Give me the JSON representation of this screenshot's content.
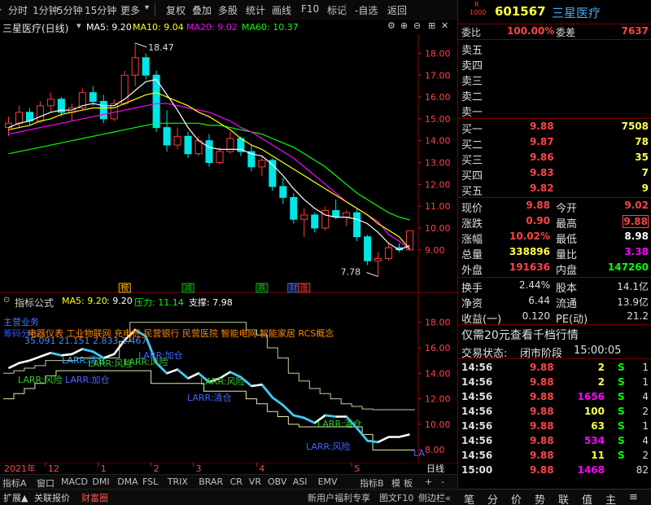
{
  "toolbar": {
    "buttons": [
      "分时",
      "1分钟",
      "5分钟",
      "15分钟",
      "更多",
      "复权",
      "叠加",
      "多股",
      "统计",
      "画线",
      "F10",
      "标记",
      "-自选",
      "返回"
    ],
    "more_arrow": "▾"
  },
  "header": {
    "stock_name": "三星医疗(日线)",
    "ma5": "MA5: 9.20",
    "ma10": "MA10: 9.04",
    "ma20": "MA20: 9.02",
    "ma60": "MA60: 10.37",
    "high_mark": "18.47",
    "low_mark": "7.78",
    "events": [
      "榜",
      "减",
      "跌",
      "财",
      "涨"
    ]
  },
  "indicator": {
    "title": "指标公式",
    "ma5": "MA5: 9.20",
    "val": ": 9.20",
    "pressure": "压力: 11.14",
    "support": "支撑: 7.98",
    "label_sector": "主营业务",
    "concepts": "电器仪表 工业物联网 充电桩 民营银行 民营医院 智能电网 智能家居 RCS概念",
    "label_cost": "筹码分布",
    "nums": "35.091 21.151 2.833 1.467",
    "larr_labels": [
      "LARR:风险",
      "LARR:清仓",
      "LARR:风险",
      "LARR:风险",
      "LARR:加仓",
      "LARR:清仓",
      "LARR:风险",
      "LARR:加仓",
      "LARR:清仓",
      "LARR:风险",
      "LA"
    ]
  },
  "axis": {
    "price_ticks": [
      "18.00",
      "17.00",
      "16.00",
      "15.00",
      "14.00",
      "13.00",
      "12.00",
      "11.00",
      "10.00",
      "9.00"
    ],
    "ind_ticks": [
      "18.00",
      "16.00",
      "14.00",
      "12.00",
      "10.00",
      "8.00"
    ],
    "time_labels": [
      "2021年",
      "12",
      "1",
      "2",
      "3",
      "4",
      "5"
    ],
    "period": "日线"
  },
  "tabs": [
    "指标A",
    "窗口",
    "MACD",
    "DMI",
    "DMA",
    "FSL",
    "TRIX",
    "BRAR",
    "CR",
    "VR",
    "OBV",
    "ASI",
    "EMV"
  ],
  "tabs_right": [
    "指标B",
    "模",
    "板",
    "+",
    "-"
  ],
  "bottom": [
    "扩展▲",
    "关联报价",
    "财富圈"
  ],
  "bottom_right": [
    "新用户福利专享",
    "图文F10",
    "侧边栏«"
  ],
  "quote": {
    "code": "601567",
    "name": "三星医疗",
    "badge_top": "R",
    "badge_bottom": "1000",
    "weibi_label": "委比",
    "weibi": "100.00%",
    "weicha_label": "委差",
    "weicha": "7637",
    "sell": [
      "卖五",
      "卖四",
      "卖三",
      "卖二",
      "卖一"
    ],
    "buy": [
      {
        "label": "买一",
        "price": "9.88",
        "vol": "7508"
      },
      {
        "label": "买二",
        "price": "9.87",
        "vol": "78"
      },
      {
        "label": "买三",
        "price": "9.86",
        "vol": "35"
      },
      {
        "label": "买四",
        "price": "9.83",
        "vol": "7"
      },
      {
        "label": "买五",
        "price": "9.82",
        "vol": "9"
      }
    ],
    "stats": [
      {
        "l1": "现价",
        "v1": "9.88",
        "l2": "今开",
        "v2": "9.02"
      },
      {
        "l1": "涨跌",
        "v1": "0.90",
        "l2": "最高",
        "v2": "9.88"
      },
      {
        "l1": "涨幅",
        "v1": "10.02%",
        "l2": "最低",
        "v2": "8.98"
      },
      {
        "l1": "总量",
        "v1": "338896",
        "l2": "量比",
        "v2": "3.38"
      },
      {
        "l1": "外盘",
        "v1": "191636",
        "l2": "内盘",
        "v2": "147260"
      }
    ],
    "stats2": [
      {
        "l1": "换手",
        "v1": "2.44%",
        "l2": "股本",
        "v2": "14.1亿"
      },
      {
        "l1": "净资",
        "v1": "6.44",
        "l2": "流通",
        "v2": "13.9亿"
      },
      {
        "l1": "收益(一)",
        "v1": "0.120",
        "l2": "PE(动)",
        "v2": "21.2"
      }
    ],
    "promo": "仅需20元查看千档行情",
    "status_label": "交易状态:",
    "status": "闭市阶段",
    "status_time": "15:00:05",
    "ticks": [
      {
        "t": "14:56",
        "p": "9.88",
        "v": "2",
        "s": "S",
        "n": "1"
      },
      {
        "t": "14:56",
        "p": "9.88",
        "v": "2",
        "s": "S",
        "n": "1"
      },
      {
        "t": "14:56",
        "p": "9.88",
        "v": "1656",
        "s": "S",
        "n": "4"
      },
      {
        "t": "14:56",
        "p": "9.88",
        "v": "100",
        "s": "S",
        "n": "2"
      },
      {
        "t": "14:56",
        "p": "9.88",
        "v": "63",
        "s": "S",
        "n": "1"
      },
      {
        "t": "14:56",
        "p": "9.88",
        "v": "534",
        "s": "S",
        "n": "4"
      },
      {
        "t": "14:56",
        "p": "9.88",
        "v": "11",
        "s": "S",
        "n": "2"
      },
      {
        "t": "15:00",
        "p": "9.88",
        "v": "1468",
        "s": "",
        "n": "82"
      }
    ],
    "side_tabs": [
      "笔",
      "分",
      "价",
      "势",
      "联",
      "值",
      "主",
      "≡"
    ]
  },
  "colors": {
    "up": "#ff3c3c",
    "down": "#00e6e6",
    "ma5": "#ffffff",
    "ma10": "#ffff00",
    "ma20": "#ff00ff",
    "ma60": "#00ff00",
    "axis": "#8a0000"
  },
  "chart_data": {
    "type": "candlestick",
    "title": "三星医疗(日线)",
    "ylim": [
      7.5,
      18.8
    ],
    "grid": false,
    "series": [
      {
        "name": "Candles",
        "values": [
          [
            14.6,
            15.1,
            14.2,
            14.8
          ],
          [
            14.8,
            15.6,
            14.6,
            15.3
          ],
          [
            15.3,
            15.5,
            14.7,
            14.9
          ],
          [
            14.9,
            15.8,
            14.8,
            15.6
          ],
          [
            15.6,
            16.2,
            15.3,
            15.9
          ],
          [
            15.9,
            16.0,
            15.1,
            15.3
          ],
          [
            15.3,
            15.7,
            14.9,
            15.5
          ],
          [
            15.5,
            16.4,
            15.4,
            16.2
          ],
          [
            16.2,
            16.5,
            15.6,
            15.8
          ],
          [
            15.8,
            16.1,
            14.8,
            15.0
          ],
          [
            15.0,
            15.9,
            14.9,
            15.7
          ],
          [
            15.7,
            17.2,
            15.6,
            17.0
          ],
          [
            17.0,
            18.47,
            16.5,
            17.8
          ],
          [
            17.8,
            18.0,
            16.8,
            17.0
          ],
          [
            17.0,
            17.2,
            14.4,
            14.6
          ],
          [
            14.6,
            15.4,
            13.5,
            13.8
          ],
          [
            13.8,
            14.6,
            13.6,
            14.2
          ],
          [
            14.2,
            14.4,
            13.2,
            13.4
          ],
          [
            13.4,
            14.2,
            13.3,
            14.0
          ],
          [
            14.0,
            14.3,
            12.8,
            13.0
          ],
          [
            13.0,
            13.7,
            12.9,
            13.5
          ],
          [
            13.5,
            14.4,
            13.4,
            14.1
          ],
          [
            14.1,
            14.2,
            13.3,
            13.5
          ],
          [
            13.5,
            13.8,
            12.6,
            12.8
          ],
          [
            12.8,
            13.3,
            12.4,
            13.1
          ],
          [
            13.1,
            13.2,
            11.7,
            11.9
          ],
          [
            11.9,
            12.3,
            11.1,
            11.4
          ],
          [
            11.4,
            11.6,
            10.2,
            10.4
          ],
          [
            10.4,
            10.9,
            9.6,
            10.6
          ],
          [
            10.6,
            10.7,
            9.8,
            10.0
          ],
          [
            10.0,
            11.0,
            9.9,
            10.8
          ],
          [
            10.8,
            11.3,
            10.4,
            10.5
          ],
          [
            10.5,
            10.8,
            10.1,
            10.7
          ],
          [
            10.7,
            10.9,
            9.4,
            9.6
          ],
          [
            9.6,
            9.7,
            8.3,
            8.5
          ],
          [
            8.5,
            8.9,
            7.78,
            8.6
          ],
          [
            8.6,
            9.3,
            8.5,
            9.1
          ],
          [
            9.1,
            9.3,
            8.9,
            9.0
          ],
          [
            9.0,
            9.9,
            8.98,
            9.88
          ]
        ]
      },
      {
        "name": "MA5",
        "values": [
          14.6,
          14.8,
          14.9,
          15.1,
          15.3,
          15.4,
          15.4,
          15.6,
          15.7,
          15.6,
          15.6,
          15.9,
          16.3,
          16.7,
          16.8,
          16.1,
          15.4,
          14.6,
          14.0,
          13.7,
          13.6,
          13.6,
          13.6,
          13.4,
          13.3,
          12.9,
          12.4,
          11.8,
          11.3,
          10.9,
          10.6,
          10.5,
          10.5,
          10.4,
          10.2,
          9.8,
          9.3,
          9.0,
          9.2
        ]
      },
      {
        "name": "MA10",
        "values": [
          14.5,
          14.6,
          14.7,
          14.9,
          15.0,
          15.2,
          15.3,
          15.4,
          15.5,
          15.5,
          15.5,
          15.7,
          15.9,
          16.1,
          16.2,
          16.0,
          15.8,
          15.6,
          15.3,
          15.1,
          14.8,
          14.5,
          14.1,
          13.8,
          13.6,
          13.3,
          13.0,
          12.7,
          12.4,
          12.1,
          11.8,
          11.5,
          11.2,
          10.9,
          10.6,
          10.2,
          9.9,
          9.6,
          9.04
        ]
      },
      {
        "name": "MA20",
        "values": [
          14.3,
          14.4,
          14.5,
          14.6,
          14.7,
          14.8,
          14.9,
          15.0,
          15.1,
          15.2,
          15.3,
          15.4,
          15.5,
          15.6,
          15.7,
          15.7,
          15.6,
          15.5,
          15.4,
          15.3,
          15.1,
          14.9,
          14.6,
          14.4,
          14.1,
          13.8,
          13.5,
          13.2,
          12.8,
          12.4,
          12.0,
          11.6,
          11.2,
          10.9,
          10.6,
          10.3,
          9.7,
          9.4,
          9.02
        ]
      },
      {
        "name": "MA60",
        "values": [
          13.4,
          13.5,
          13.6,
          13.7,
          13.8,
          13.9,
          14.0,
          14.1,
          14.2,
          14.3,
          14.4,
          14.5,
          14.6,
          14.7,
          14.8,
          14.8,
          14.8,
          14.8,
          14.8,
          14.7,
          14.7,
          14.6,
          14.5,
          14.4,
          14.3,
          14.1,
          13.9,
          13.7,
          13.4,
          13.1,
          12.8,
          12.4,
          12.0,
          11.6,
          11.3,
          11.0,
          10.7,
          10.5,
          10.37
        ]
      },
      {
        "name": "LARR",
        "values": [
          14.4,
          14.8,
          15.0,
          15.3,
          15.6,
          15.4,
          15.5,
          15.9,
          15.7,
          15.2,
          15.5,
          16.6,
          17.4,
          16.9,
          14.8,
          14.0,
          14.3,
          13.6,
          14.0,
          13.3,
          13.6,
          14.1,
          13.7,
          13.0,
          13.1,
          12.1,
          11.5,
          10.7,
          10.5,
          10.1,
          10.7,
          10.6,
          10.6,
          9.7,
          8.7,
          8.6,
          9.0,
          9.0,
          9.2
        ]
      },
      {
        "name": "压力",
        "values": [
          14.0,
          14.2,
          14.4,
          14.6,
          15.0,
          15.0,
          15.0,
          15.2,
          15.2,
          15.2,
          15.2,
          16.5,
          18.0,
          18.0,
          18.0,
          18.0,
          18.0,
          18.0,
          18.0,
          18.0,
          18.0,
          18.0,
          18.0,
          17.4,
          17.0,
          16.0,
          15.2,
          14.0,
          13.4,
          12.8,
          12.4,
          12.0,
          11.6,
          11.4,
          11.2,
          11.14,
          11.14,
          11.14,
          11.14
        ]
      },
      {
        "name": "支撑",
        "values": [
          12.0,
          12.4,
          12.8,
          13.2,
          13.8,
          14.2,
          14.2,
          14.2,
          14.2,
          14.2,
          14.2,
          14.2,
          14.2,
          14.2,
          13.2,
          13.2,
          13.2,
          13.2,
          13.2,
          12.6,
          12.6,
          12.6,
          12.6,
          12.0,
          11.6,
          11.0,
          10.6,
          10.0,
          9.8,
          9.8,
          9.8,
          9.8,
          9.8,
          9.8,
          9.2,
          7.98,
          7.98,
          7.98,
          7.98
        ]
      }
    ]
  }
}
